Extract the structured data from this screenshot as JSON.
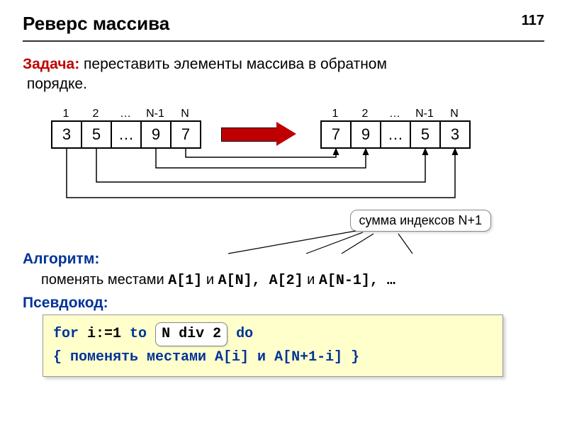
{
  "page_number": "117",
  "title": "Реверс массива",
  "task": {
    "label": "Задача:",
    "text1": " переставить элементы массива в обратном",
    "text2": "порядке."
  },
  "left_array": {
    "headers": [
      "1",
      "2",
      "…",
      "N-1",
      "N"
    ],
    "cells": [
      "3",
      "5",
      "…",
      "9",
      "7"
    ]
  },
  "right_array": {
    "headers": [
      "1",
      "2",
      "…",
      "N-1",
      "N"
    ],
    "cells": [
      "7",
      "9",
      "…",
      "5",
      "3"
    ]
  },
  "callout": "сумма индексов N+1",
  "algorithm_label": "Алгоритм:",
  "swap_line": {
    "pre": "поменять местами ",
    "a1": "A[1]",
    "mid1": " и ",
    "an": "A[N]",
    "sep": ", ",
    "a2": "A[2]",
    "mid2": " и ",
    "an1": "A[N-1]",
    "tail": ", …"
  },
  "pseudocode_label": "Псевдокод:",
  "code": {
    "for": "for",
    "i1": " i:=1 ",
    "to": "to",
    "ndiv2": "N div 2",
    "do": " do",
    "brace_open": " { ",
    "body": "поменять местами A[i] и A[N+1-i]",
    "brace_close": " }"
  }
}
